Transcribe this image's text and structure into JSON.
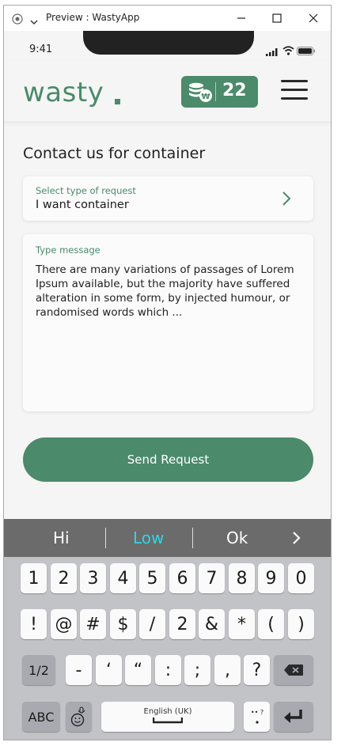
{
  "window": {
    "title": "Preview : WastyApp"
  },
  "status": {
    "time": "9:41"
  },
  "header": {
    "logo": "wasty",
    "coins": "22"
  },
  "page": {
    "title": "Contact us for container"
  },
  "request_select": {
    "label": "Select type of request",
    "value": "I want container"
  },
  "message": {
    "label": "Type message",
    "value": "There are many variations of passages of Lorem Ipsum available, but the majority have suffered alteration in some form, by injected humour, or randomised words which ..."
  },
  "send_button": {
    "label": "Send Request"
  },
  "keyboard": {
    "suggestions": [
      "Hi",
      "Low",
      "Ok"
    ],
    "row1": [
      "1",
      "2",
      "3",
      "4",
      "5",
      "6",
      "7",
      "8",
      "9",
      "0"
    ],
    "row2": [
      "!",
      "@",
      "#",
      "$",
      "/",
      "2",
      "&",
      "*",
      "(",
      ")"
    ],
    "row3": [
      "-",
      "‘",
      "“",
      ":",
      ";",
      ",",
      "?"
    ],
    "mode_key": "1/2",
    "abc_key": "ABC",
    "space_label": "English (UK)"
  },
  "colors": {
    "accent": "#4b8a6a",
    "suggestion_highlight": "#2fd6e6"
  }
}
